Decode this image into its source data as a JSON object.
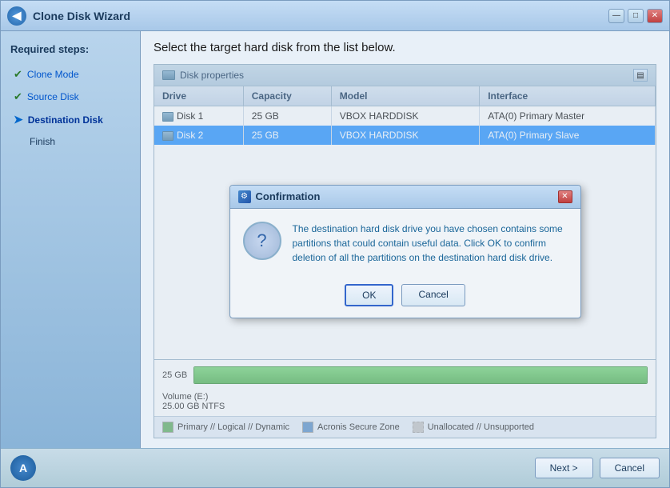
{
  "window": {
    "title": "Clone Disk Wizard",
    "title_icon": "◀",
    "minimize_label": "—",
    "maximize_label": "□",
    "close_label": "✕"
  },
  "sidebar": {
    "required_steps_label": "Required steps:",
    "items": [
      {
        "id": "clone-mode",
        "label": "Clone Mode",
        "status": "check"
      },
      {
        "id": "source-disk",
        "label": "Source Disk",
        "status": "check"
      },
      {
        "id": "destination-disk",
        "label": "Destination Disk",
        "status": "active"
      },
      {
        "id": "finish",
        "label": "Finish",
        "status": "none"
      }
    ]
  },
  "page_title": "Select the target hard disk from the list below.",
  "disk_properties": {
    "header_label": "Disk properties",
    "columns": [
      "Drive",
      "Capacity",
      "Model",
      "Interface"
    ],
    "rows": [
      {
        "drive": "Disk 1",
        "capacity": "25 GB",
        "model": "VBOX HARDDISK",
        "interface": "ATA(0) Primary Master",
        "selected": false
      },
      {
        "drive": "Disk 2",
        "capacity": "25 GB",
        "model": "VBOX HARDDISK",
        "interface": "ATA(0) Primary Slave",
        "selected": true
      }
    ]
  },
  "disk_visual": {
    "size_label": "25 GB",
    "volume_name": "Volume (E:)",
    "volume_size": "25.00 GB  NTFS"
  },
  "legend": {
    "items": [
      {
        "id": "primary",
        "color": "green",
        "label": "Primary // Logical // Dynamic"
      },
      {
        "id": "secure-zone",
        "color": "blue",
        "label": "Acronis Secure Zone"
      },
      {
        "id": "unallocated",
        "color": "gray",
        "label": "Unallocated // Unsupported"
      }
    ]
  },
  "confirmation_dialog": {
    "title": "Confirmation",
    "message": "The destination hard disk drive you have chosen contains some partitions that could contain useful data. Click OK to confirm deletion of all the partitions on the destination hard disk drive.",
    "ok_label": "OK",
    "cancel_label": "Cancel",
    "warning_icon": "?"
  },
  "footer": {
    "next_label": "Next >",
    "cancel_label": "Cancel",
    "logo_text": "A"
  }
}
